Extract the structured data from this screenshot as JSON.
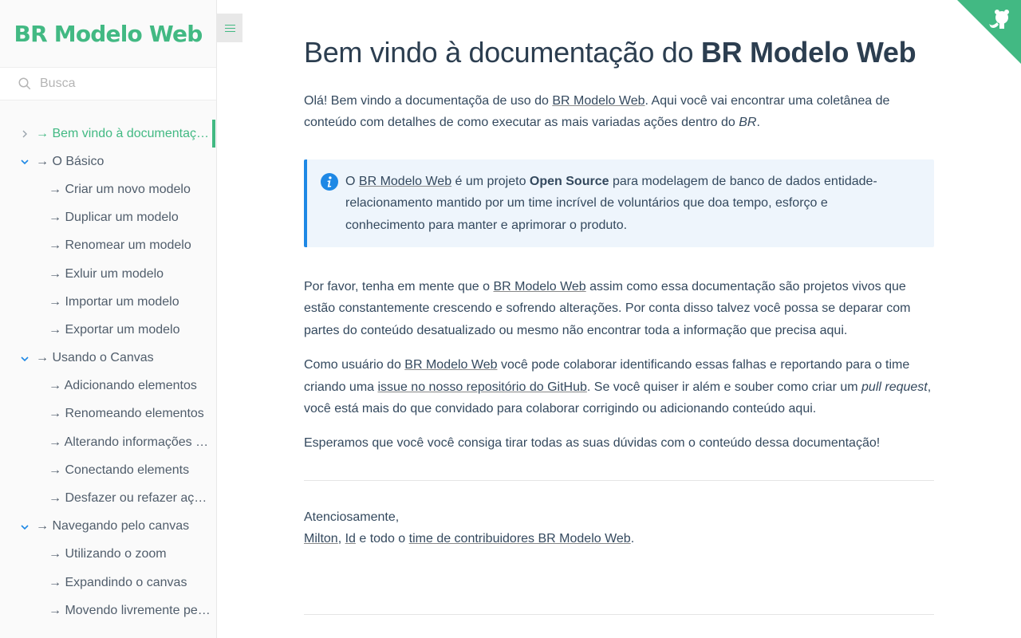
{
  "app": {
    "name": "BR Modelo Web"
  },
  "search": {
    "placeholder": "Busca"
  },
  "nav": [
    {
      "label": "→ Bem vindo à documentação do BR Modelo Web",
      "expanded": false,
      "level": 0,
      "active": true
    },
    {
      "label": "→ O Básico",
      "expanded": true,
      "level": 0
    },
    {
      "label": "→ Criar um novo modelo",
      "level": 1
    },
    {
      "label": "→ Duplicar um modelo",
      "level": 1
    },
    {
      "label": "→ Renomear um modelo",
      "level": 1
    },
    {
      "label": "→ Exluir um modelo",
      "level": 1
    },
    {
      "label": "→ Importar um modelo",
      "level": 1
    },
    {
      "label": "→ Exportar um modelo",
      "level": 1
    },
    {
      "label": "→ Usando o Canvas",
      "expanded": true,
      "level": 0
    },
    {
      "label": "→ Adicionando elementos",
      "level": 1
    },
    {
      "label": "→ Renomeando elementos",
      "level": 1
    },
    {
      "label": "→ Alterando informações dos elementos",
      "level": 1
    },
    {
      "label": "→ Conectando elements",
      "level": 1
    },
    {
      "label": "→ Desfazer ou refazer ações",
      "level": 1
    },
    {
      "label": "→ Navegando pelo canvas",
      "expanded": true,
      "level": 0
    },
    {
      "label": "→ Utilizando o zoom",
      "level": 1
    },
    {
      "label": "→ Expandindo o canvas",
      "level": 1
    },
    {
      "label": "→ Movendo livremente pelo canvas",
      "level": 1
    }
  ],
  "main": {
    "title_pre": "Bem vindo à documentação do ",
    "title_bold": "BR Modelo Web",
    "p1": {
      "a": "Olá! Bem vindo a documentaçõa de uso do ",
      "link": "BR Modelo Web",
      "b": ". Aqui você vai encontrar uma coletânea de conteúdo com detalhes de como executar as mais variadas ações dentro do ",
      "em": "BR",
      "c": "."
    },
    "tip": {
      "a": "O ",
      "link": "BR Modelo Web",
      "b": " é um projeto ",
      "strong": "Open Source",
      "c": " para modelagem de banco de dados entidade-relacionamento mantido por um time incrível de voluntários que doa tempo, esforço e conhecimento para manter e aprimorar o produto."
    },
    "p2": {
      "a": "Por favor, tenha em mente que o ",
      "link": "BR Modelo Web",
      "b": " assim como essa documentação são projetos vivos que estão constantemente crescendo e sofrendo alterações. Por conta disso talvez você possa se deparar com partes do conteúdo desatualizado ou mesmo não encontrar toda a informação que precisa aqui."
    },
    "p3": {
      "a": "Como usuário do ",
      "link1": "BR Modelo Web",
      "b": " você pode colaborar identificando essas falhas e reportando para o time criando uma ",
      "link2": "issue no nosso repositório do GitHub",
      "c": ". Se você quiser ir além e souber como criar um ",
      "em": "pull request",
      "d": ", você está mais do que convidado para colaborar corrigindo ou adicionando conteúdo aqui."
    },
    "p4": "Esperamos que você você consiga tirar todas as suas dúvidas com o conteúdo dessa documentação!",
    "sign": {
      "greeting": "Atenciosamente,",
      "link1": "Milton",
      "sep1": ", ",
      "link2": "Id",
      "mid": " e todo o ",
      "link3": "time de contribuidores BR Modelo Web",
      "end": "."
    }
  },
  "colors": {
    "accent": "#42b983",
    "tip_border": "#1e88e5",
    "tip_bg": "#eef5fc"
  },
  "icons": {
    "search": "search-icon",
    "chevron_right": "chevron-right-icon",
    "chevron_down": "chevron-down-icon",
    "menu": "hamburger-icon",
    "info": "info-icon",
    "github": "github-octocat-icon"
  }
}
